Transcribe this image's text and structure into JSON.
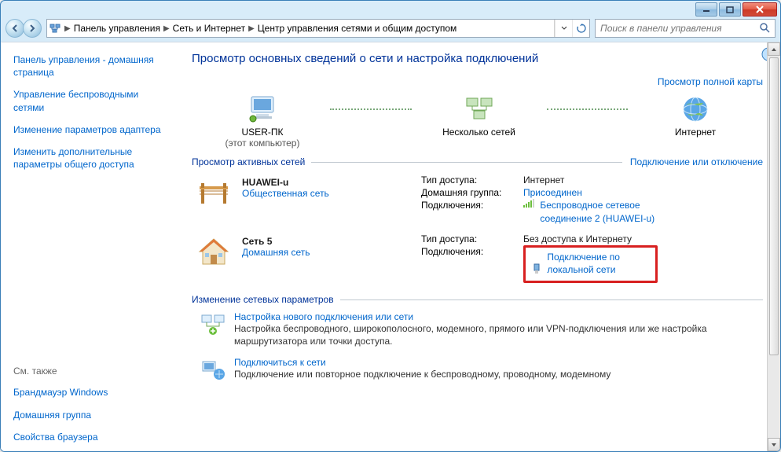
{
  "breadcrumb": {
    "p1": "Панель управления",
    "p2": "Сеть и Интернет",
    "p3": "Центр управления сетями и общим доступом"
  },
  "search": {
    "placeholder": "Поиск в панели управления"
  },
  "sidebar": {
    "home": "Панель управления - домашняя страница",
    "wireless": "Управление беспроводными сетями",
    "adapter": "Изменение параметров адаптера",
    "sharing": "Изменить дополнительные параметры общего доступа",
    "seealso_title": "См. также",
    "firewall": "Брандмауэр Windows",
    "homegroup": "Домашняя группа",
    "browser": "Свойства браузера"
  },
  "main": {
    "heading": "Просмотр основных сведений о сети и настройка подключений",
    "viewmap": "Просмотр полной карты",
    "node1_t": "USER-ПК",
    "node1_s": "(этот компьютер)",
    "node2_t": "Несколько сетей",
    "node3_t": "Интернет",
    "sect_active_title": "Просмотр активных сетей",
    "sect_active_right": "Подключение или отключение",
    "net1": {
      "name": "HUAWEI-u",
      "type": "Общественная сеть",
      "k1": "Тип доступа:",
      "v1": "Интернет",
      "k2": "Домашняя группа:",
      "v2": "Присоединен",
      "k3": "Подключения:",
      "v3": "Беспроводное сетевое соединение 2 (HUAWEI-u)"
    },
    "net2": {
      "name": "Сеть  5",
      "type": "Домашняя сеть",
      "k1": "Тип доступа:",
      "v1": "Без доступа к Интернету",
      "k2": "Подключения:",
      "v2": "Подключение по локальной сети"
    },
    "sect_change_title": "Изменение сетевых параметров",
    "act1_t": "Настройка нового подключения или сети",
    "act1_d": "Настройка беспроводного, широкополосного, модемного, прямого или VPN-подключения или же настройка маршрутизатора или точки доступа.",
    "act2_t": "Подключиться к сети",
    "act2_d": "Подключение или повторное подключение к беспроводному, проводному, модемному"
  }
}
